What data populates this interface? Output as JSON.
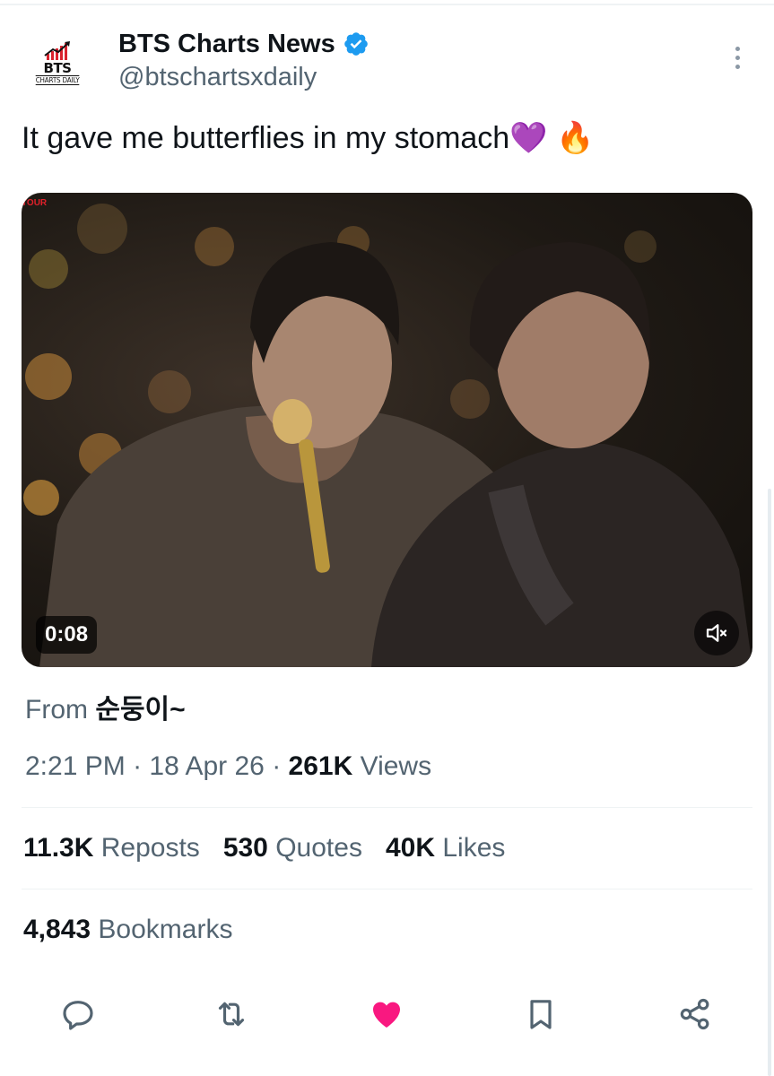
{
  "account": {
    "display_name": "BTS Charts News",
    "handle": "@btschartsxdaily",
    "avatar_brand": "BTS",
    "avatar_sub": "CHARTS DAILY",
    "verified": true
  },
  "tweet": {
    "text": "It gave me butterflies in my stomach💜 🔥"
  },
  "media": {
    "duration": "0:08",
    "muted": true,
    "channel_logo": "TOUR"
  },
  "source": {
    "prefix": "From",
    "name": "순둥이~"
  },
  "meta": {
    "time": "2:21 PM",
    "date": "18 Apr 26",
    "views_count": "261K",
    "views_label": "Views",
    "separator": "·"
  },
  "stats": {
    "reposts_count": "11.3K",
    "reposts_label": "Reposts",
    "quotes_count": "530",
    "quotes_label": "Quotes",
    "likes_count": "40K",
    "likes_label": "Likes",
    "bookmarks_count": "4,843",
    "bookmarks_label": "Bookmarks"
  },
  "actions": [
    {
      "icon": "reply-icon"
    },
    {
      "icon": "repost-icon"
    },
    {
      "icon": "like-icon",
      "active": true
    },
    {
      "icon": "bookmark-icon"
    },
    {
      "icon": "share-icon"
    }
  ],
  "colors": {
    "verified": "#1d9bf0",
    "like_active": "#f91880",
    "secondary_text": "#536471",
    "primary_text": "#0f1419"
  }
}
